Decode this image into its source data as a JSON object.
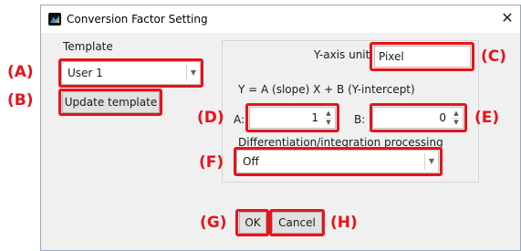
{
  "window": {
    "title": "Conversion Factor Setting",
    "close_glyph": "✕"
  },
  "template": {
    "label": "Template",
    "selected": "User 1",
    "update_button": "Update template"
  },
  "y_axis": {
    "label": "Y-axis unit",
    "value": "Pixel"
  },
  "formula": "Y = A (slope) X + B (Y-intercept)",
  "a_field": {
    "label": "A:",
    "value": "1"
  },
  "b_field": {
    "label": "B:",
    "value": "0"
  },
  "processing": {
    "label": "Differentiation/integration processing",
    "selected": "Off"
  },
  "buttons": {
    "ok": "OK",
    "cancel": "Cancel"
  },
  "callouts": {
    "a": "(A)",
    "b": "(B)",
    "c": "(C)",
    "d": "(D)",
    "e": "(E)",
    "f": "(F)",
    "g": "(G)",
    "h": "(H)"
  },
  "colors": {
    "highlight": "#e8131b",
    "dialog_bg": "#f0f0f0"
  },
  "icons": {
    "app": "graph-app-icon",
    "close": "close-icon",
    "dropdown": "chevron-down-icon"
  }
}
